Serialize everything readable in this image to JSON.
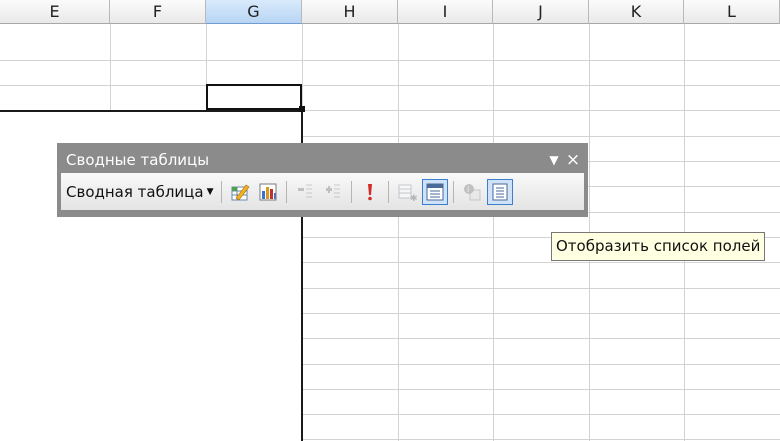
{
  "columns": [
    {
      "label": "E",
      "selected": false
    },
    {
      "label": "F",
      "selected": false
    },
    {
      "label": "G",
      "selected": true
    },
    {
      "label": "H",
      "selected": false
    },
    {
      "label": "I",
      "selected": false
    },
    {
      "label": "J",
      "selected": false
    },
    {
      "label": "K",
      "selected": false
    },
    {
      "label": "L",
      "selected": false
    }
  ],
  "toolbar": {
    "title": "Сводные таблицы",
    "menu_icon": "dropdown-triangle-icon",
    "close_icon": "close-icon",
    "dropdown_label": "Сводная таблица",
    "buttons": [
      {
        "name": "format-report-button",
        "icon": "format-report-icon",
        "state": "normal"
      },
      {
        "name": "pivot-chart-button",
        "icon": "chart-icon",
        "state": "normal"
      },
      {
        "name": "hide-detail-button",
        "icon": "hide-detail-icon",
        "state": "disabled"
      },
      {
        "name": "show-detail-button",
        "icon": "show-detail-icon",
        "state": "disabled"
      },
      {
        "name": "refresh-data-button",
        "icon": "exclamation-icon",
        "state": "normal"
      },
      {
        "name": "include-hidden-items-button",
        "icon": "hidden-items-icon",
        "state": "disabled"
      },
      {
        "name": "always-display-items-button",
        "icon": "display-items-icon",
        "state": "active"
      },
      {
        "name": "field-settings-button",
        "icon": "field-settings-icon",
        "state": "disabled"
      },
      {
        "name": "field-list-button",
        "icon": "field-list-icon",
        "state": "active"
      }
    ]
  },
  "tooltip": {
    "text": "Отобразить список полей"
  },
  "colors": {
    "toolbar_frame": "#8b8b8b",
    "selected_header": "#b8d5f4",
    "active_button_border": "#3c7fd0",
    "tooltip_bg": "#ffffe1"
  }
}
